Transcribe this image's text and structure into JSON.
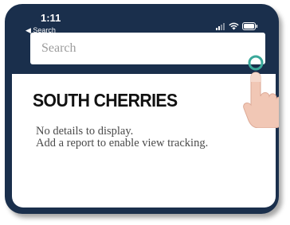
{
  "status_bar": {
    "time": "1:11",
    "back_app": "◀ Search",
    "icons": [
      "signal-icon",
      "wifi-icon",
      "battery-icon"
    ]
  },
  "search": {
    "placeholder": "Search",
    "value": ""
  },
  "item": {
    "title": "SOUTH CHERRIES",
    "details_line1": "No details to display.",
    "details_line2": "Add a report to enable view tracking.",
    "chevron_icon": "chevron-right-icon"
  },
  "colors": {
    "frame": "#1a2f4c",
    "tap_ring": "#3aa89a",
    "hand": "#f1c7b5"
  }
}
